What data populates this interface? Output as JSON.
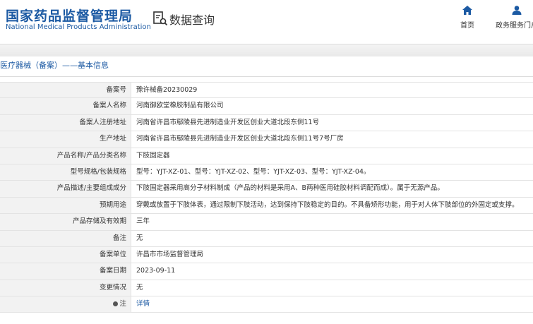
{
  "header": {
    "logo_cn": "国家药品监督管理局",
    "logo_en": "National Medical Products Administration",
    "page_title": "数据查询",
    "nav": [
      {
        "label": "首页",
        "icon": "home-icon"
      },
      {
        "label": "政务服务门户",
        "icon": "user-icon"
      }
    ]
  },
  "section": {
    "title": "医疗器械（备案）——基本信息"
  },
  "rows": [
    {
      "label": "备案号",
      "value": "豫许械备20230029"
    },
    {
      "label": "备案人名称",
      "value": "河南御欧堂橡胶制品有限公司"
    },
    {
      "label": "备案人注册地址",
      "value": "河南省许昌市鄢陵县先进制造业开发区创业大道北段东侧11号"
    },
    {
      "label": "生产地址",
      "value": "河南省许昌市鄢陵县先进制造业开发区创业大道北段东侧11号7号厂房"
    },
    {
      "label": "产品名称/产品分类名称",
      "value": "下肢固定器"
    },
    {
      "label": "型号规格/包装规格",
      "value": "型号：YJT-XZ-01、型号：YJT-XZ-02、型号：YJT-XZ-03、型号：YJT-XZ-04。"
    },
    {
      "label": "产品描述/主要组成成分",
      "value": "下肢固定器采用高分子材料制成（产品的材料是采用A、B两种医用硅胶材料调配而成）。属于无源产品。"
    },
    {
      "label": "预期用途",
      "value": "穿戴或放置于下肢体表，通过限制下肢活动，达到保持下肢稳定的目的。不具备矫形功能，用于对人体下肢部位的外固定或支撑。"
    },
    {
      "label": "产品存储及有效期",
      "value": "三年"
    },
    {
      "label": "备注",
      "value": "无"
    },
    {
      "label": "备案单位",
      "value": "许昌市市场监督管理局"
    },
    {
      "label": "备案日期",
      "value": "2023-09-11"
    },
    {
      "label": "变更情况",
      "value": "无"
    },
    {
      "label": "注",
      "value": "详情"
    }
  ],
  "colors": {
    "brand": "#1c5aa3",
    "label_bg": "#f2f2f2",
    "border": "#e3e3e3"
  }
}
